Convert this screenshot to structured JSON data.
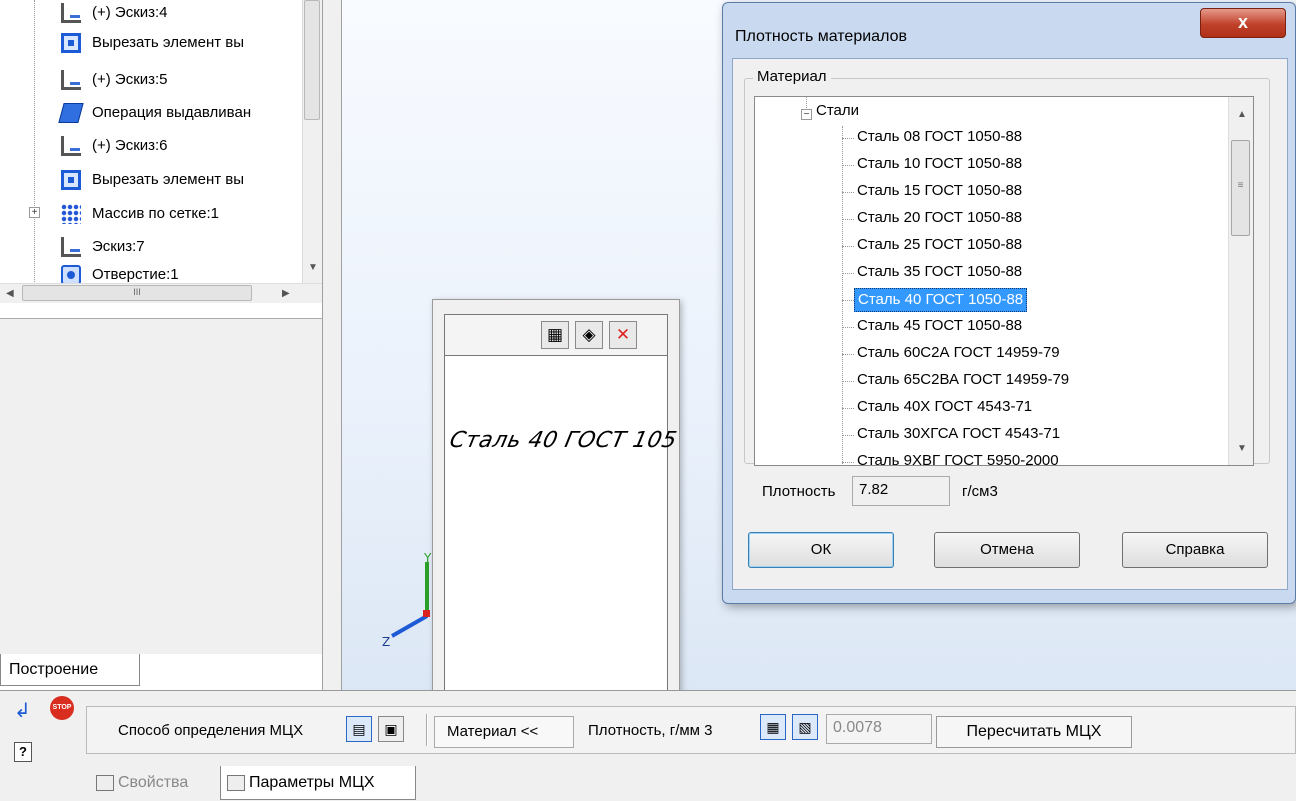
{
  "tree": {
    "items": [
      {
        "label": "(+) Эскиз:4",
        "icon": "sketch-icon"
      },
      {
        "label": "Вырезать элемент вы",
        "icon": "cut-extrude-icon"
      },
      {
        "label": "(+) Эскиз:5",
        "icon": "sketch-icon"
      },
      {
        "label": "Операция выдавливан",
        "icon": "extrude-icon"
      },
      {
        "label": "(+) Эскиз:6",
        "icon": "sketch-icon"
      },
      {
        "label": "Вырезать элемент вы",
        "icon": "cut-extrude-icon"
      },
      {
        "label": "Массив по сетке:1",
        "icon": "grid-array-icon"
      },
      {
        "label": "Эскиз:7",
        "icon": "sketch-icon"
      },
      {
        "label": "Отверстие:1",
        "icon": "hole-icon"
      }
    ],
    "hscroll_glyph": "III",
    "tab_label": "Построение"
  },
  "viewport": {
    "axis_labels": {
      "y": "Y",
      "z": "Z"
    }
  },
  "material_float": {
    "text": "Сталь 40  ГОСТ 105"
  },
  "dialog": {
    "title": "Плотность материалов",
    "close_glyph": "x",
    "group_label": "Материал",
    "root_label": "Стали",
    "materials": [
      "Сталь 08  ГОСТ 1050-88",
      "Сталь 10  ГОСТ 1050-88",
      "Сталь 15  ГОСТ 1050-88",
      "Сталь 20  ГОСТ 1050-88",
      "Сталь 25  ГОСТ 1050-88",
      "Сталь 35  ГОСТ 1050-88",
      "Сталь 40  ГОСТ 1050-88",
      "Сталь 45  ГОСТ 1050-88",
      "Сталь 60С2А  ГОСТ 14959-79",
      "Сталь 65С2ВА  ГОСТ 14959-79",
      "Сталь 40Х  ГОСТ 4543-71",
      "Сталь 30ХГСА  ГОСТ 4543-71",
      "Сталь 9ХВГ  ГОСТ 5950-2000"
    ],
    "selected_material": "Сталь 40  ГОСТ 1050-88",
    "density_label": "Плотность",
    "density_value": "7.82",
    "density_unit": "г/см3",
    "ok_label": "ОК",
    "cancel_label": "Отмена",
    "help_label": "Справка"
  },
  "bottom": {
    "method_label": "Способ определения МЦХ",
    "material_button": "Материал  <<",
    "density_label": "Плотность, г/мм 3",
    "density_value": "0.0078",
    "recalc_label": "Пересчитать МЦХ",
    "tab_properties": "Свойства",
    "tab_params": "Параметры МЦХ",
    "stop_text": "STOP",
    "help_glyph": "?"
  }
}
